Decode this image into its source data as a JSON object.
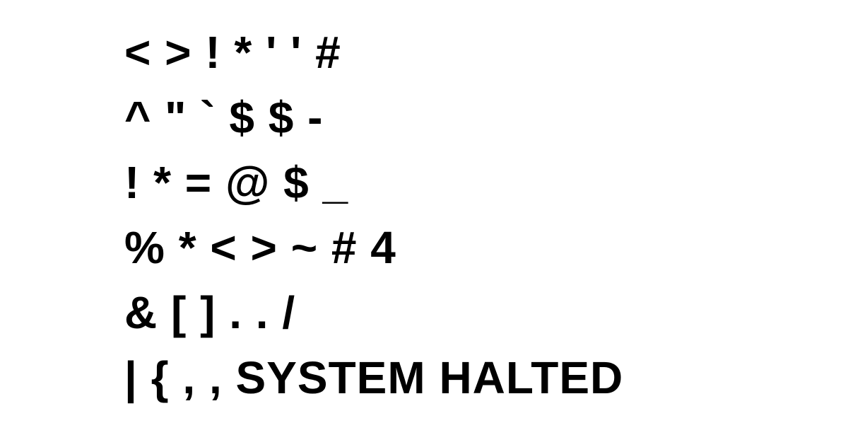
{
  "screen": {
    "background": "#ffffff",
    "text_color": "#000000",
    "lines": [
      "< > ! * ' ' #",
      "^ \" ` $ $ -",
      "! * = @ $ _",
      "% * < > ~ # 4",
      "& [ ] . . /",
      "| { , , SYSTEM HALTED"
    ]
  }
}
